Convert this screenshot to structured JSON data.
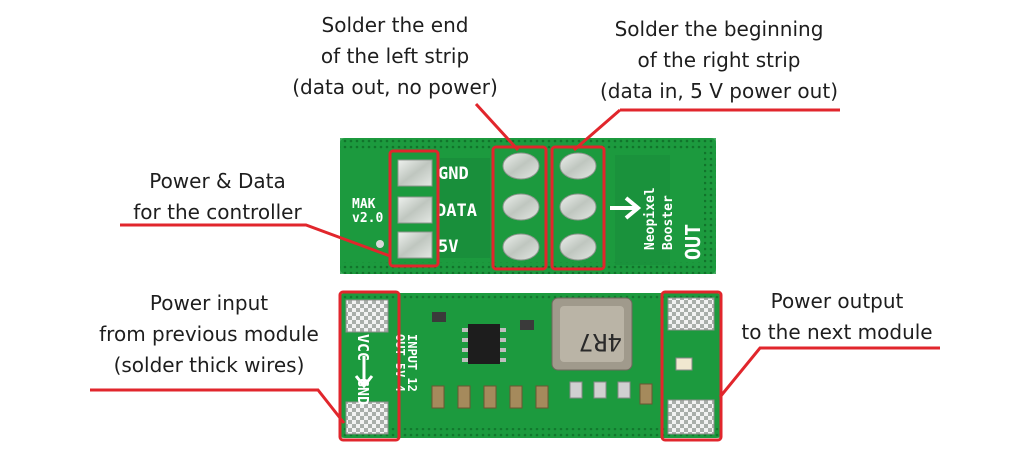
{
  "captions": {
    "left_strip_end": [
      "Solder the end",
      "of the left strip",
      "(data out, no power)"
    ],
    "right_strip_begin": [
      "Solder the beginning",
      "of the right strip",
      "(data in, 5 V power out)"
    ],
    "power_data_controller": [
      "Power & Data",
      "for the controller"
    ],
    "power_input": [
      "Power input",
      "from previous module",
      "(solder thick wires)"
    ],
    "power_output": [
      "Power output",
      "to the next module"
    ]
  },
  "board_top_silkscreen": {
    "row_labels": [
      "GND",
      "DATA",
      "5V"
    ],
    "brand": [
      "MAK",
      "v2.0"
    ],
    "product": [
      "Neopixel",
      "Booster"
    ],
    "out_label": "OUT"
  },
  "board_bottom_silkscreen": {
    "vcc_label": "VCC",
    "gnd_label": "GND",
    "out_spec": "OUT 5V 4",
    "in_spec": "INPUT 12",
    "inductor_marking": "4R7"
  },
  "colors": {
    "pcb_green": "#1c9a3e",
    "pcb_dark": "#117a2e",
    "pad_silver": "#c9cfc9",
    "highlight_red": "#e1262c",
    "text": "#1e1e1e"
  }
}
